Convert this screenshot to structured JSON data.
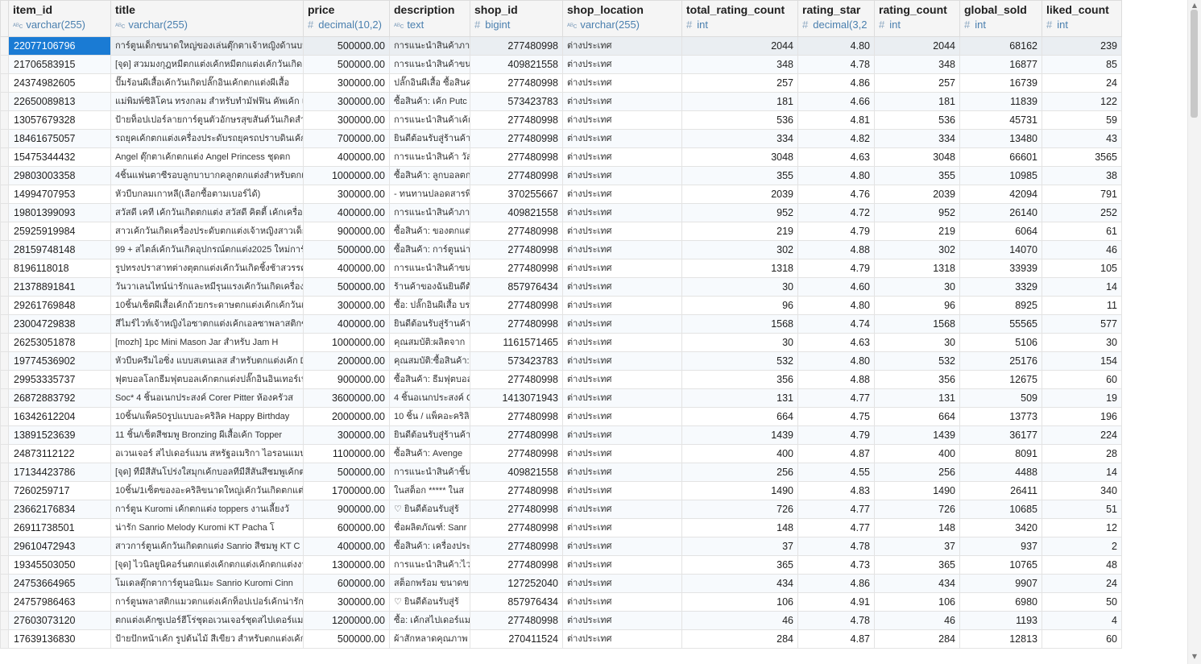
{
  "columns": [
    {
      "name": "item_id",
      "type": "varchar(255)",
      "kind": "text"
    },
    {
      "name": "title",
      "type": "varchar(255)",
      "kind": "text"
    },
    {
      "name": "price",
      "type": "decimal(10,2)",
      "kind": "number"
    },
    {
      "name": "description",
      "type": "text",
      "kind": "text"
    },
    {
      "name": "shop_id",
      "type": "bigint",
      "kind": "number"
    },
    {
      "name": "shop_location",
      "type": "varchar(255)",
      "kind": "text"
    },
    {
      "name": "total_rating_count",
      "type": "int",
      "kind": "number"
    },
    {
      "name": "rating_star",
      "type": "decimal(3,2",
      "kind": "number"
    },
    {
      "name": "rating_count",
      "type": "int",
      "kind": "number"
    },
    {
      "name": "global_sold",
      "type": "int",
      "kind": "number"
    },
    {
      "name": "liked_count",
      "type": "int",
      "kind": "number"
    }
  ],
  "rows": [
    [
      "22077106796",
      "การ์ตูนเด็กขนาดใหญ่ของเล่นตุ๊กตาเจ้าหญิงด้านบนมี",
      "500000.00",
      "การแนะนำสินค้าภาษ",
      "277480998",
      "ต่างประเทศ",
      "2044",
      "4.80",
      "2044",
      "68162",
      "239"
    ],
    [
      "21706583915",
      "[จุด] สวมมงกุฎหมีตกแต่งเค้กหมีตกแต่งเค้กวันเกิด",
      "500000.00",
      "การแนะนำสินค้าขนา",
      "409821558",
      "ต่างประเทศ",
      "348",
      "4.78",
      "348",
      "16877",
      "85"
    ],
    [
      "24374982605",
      "ปั๊มร้อนผีเสื้อเค้กวันเกิดปลั๊กอินเค้กตกแต่งผีเสื้อ",
      "300000.00",
      "ปลั๊กอินผีเสื้อ ซื้อสินค",
      "277480998",
      "ต่างประเทศ",
      "257",
      "4.86",
      "257",
      "16739",
      "24"
    ],
    [
      "22650089813",
      "แม่พิมพ์ซิลิโคน ทรงกลม สำหรับทำมัฟฟิน คัพเค้ก แ",
      "300000.00",
      "ซื้อสินค้า: เค้ก Putc",
      "573423783",
      "ต่างประเทศ",
      "181",
      "4.66",
      "181",
      "11839",
      "122"
    ],
    [
      "13057679328",
      "ป้ายท็อปเปอร์ลายการ์ตูนตัวอักษรสุขสันต์วันเกิดสำหร",
      "300000.00",
      "การแนะนำสินค้าเค้ก",
      "277480998",
      "ต่างประเทศ",
      "536",
      "4.81",
      "536",
      "45731",
      "59"
    ],
    [
      "18461675057",
      "รถยุคเค้กตกแต่งเครื่องประดับรถยุครถปราบดินเค้ก",
      "700000.00",
      "ยินดีต้อนรับสู่ร้านค้า",
      "277480998",
      "ต่างประเทศ",
      "334",
      "4.82",
      "334",
      "13480",
      "43"
    ],
    [
      "15475344432",
      "Angel ตุ๊กตาเค้กตกแต่ง Angel Princess ชุดตก",
      "400000.00",
      "การแนะนำสินค้า วัสด",
      "277480998",
      "ต่างประเทศ",
      "3048",
      "4.63",
      "3048",
      "66601",
      "3565"
    ],
    [
      "29803003358",
      "4ชิ้นแฟนตาซีรอบลูกบาบากคลูกตกแต่งสำหรับตกแ",
      "1000000.00",
      "ซื้อสินค้า: ลูกบอลตก",
      "277480998",
      "ต่างประเทศ",
      "355",
      "4.80",
      "355",
      "10985",
      "38"
    ],
    [
      "14994707953",
      "หัวบีบกลมเกาหลี(เลือกซื้อตามเบอร์ได้)",
      "300000.00",
      "- ทนทานปลอดสารพิ",
      "370255667",
      "ต่างประเทศ",
      "2039",
      "4.76",
      "2039",
      "42094",
      "791"
    ],
    [
      "19801399093",
      "สวัสดี เคที เค้กวันเกิดตกแต่ง สวัสดี คิตตี้ เค้กเครื่องแ",
      "400000.00",
      "การแนะนำสินค้าภาษ",
      "409821558",
      "ต่างประเทศ",
      "952",
      "4.72",
      "952",
      "26140",
      "252"
    ],
    [
      "25925919984",
      "สาวเค้กวันเกิดเครื่องประดับตกแต่งเจ้าหญิงสาวเด็กอ",
      "900000.00",
      "ซื้อสินค้า: ของตกแต่",
      "277480998",
      "ต่างประเทศ",
      "219",
      "4.79",
      "219",
      "6064",
      "61"
    ],
    [
      "28159748148",
      "99 + สไตล์เค้กวันเกิดอุปกรณ์ตกแต่ง2025 ใหม่การ์",
      "500000.00",
      "ซื้อสินค้า: การ์ตูนน่า",
      "277480998",
      "ต่างประเทศ",
      "302",
      "4.88",
      "302",
      "14070",
      "46"
    ],
    [
      "8196118018",
      "รูปทรงปราสาทต่างตุตกแต่งเค้กวันเกิดชิ้งช้าสวรรค์เจ้",
      "400000.00",
      "การแนะนำสินค้าขนา",
      "277480998",
      "ต่างประเทศ",
      "1318",
      "4.79",
      "1318",
      "33939",
      "105"
    ],
    [
      "21378891841",
      "วันวาเลนไทน์น่ารักและหมีรุนแรงเค้กวันเกิดเครื่องประ",
      "500000.00",
      "ร้านค้าของฉันยินดีต้",
      "857976434",
      "ต่างประเทศ",
      "30",
      "4.60",
      "30",
      "3329",
      "14"
    ],
    [
      "29261769848",
      "10ชิ้น/เซ็ตผีเสื้อเค้กถ้วยกระดาษตกแต่งเค้กเค้กวันเกิ",
      "300000.00",
      "ซื้อ: ปลั๊กอินผีเสื้อ บร",
      "277480998",
      "ต่างประเทศ",
      "96",
      "4.80",
      "96",
      "8925",
      "11"
    ],
    [
      "23004729838",
      "สีไมร์ไวท์เจ้าหญิงไอซาตกแต่งเค้กเอลซาพลาสติกของ",
      "400000.00",
      "ยินดีต้อนรับสู่ร้านค้า",
      "277480998",
      "ต่างประเทศ",
      "1568",
      "4.74",
      "1568",
      "55565",
      "577"
    ],
    [
      "26253051878",
      "[mozh] 1pc Mini Mason Jar สำหรับ Jam H",
      "1000000.00",
      "คุณสมบัติ:ผลิตจาก",
      "1161571465",
      "ต่างประเทศ",
      "30",
      "4.63",
      "30",
      "5106",
      "30"
    ],
    [
      "19774536902",
      "หัวบีบครีมไอซิ่ง แบบสเตนเลส สำหรับตกแต่งเค้ก DI",
      "200000.00",
      "คุณสมบัติ:ซื้อสินค้า:",
      "573423783",
      "ต่างประเทศ",
      "532",
      "4.80",
      "532",
      "25176",
      "154"
    ],
    [
      "29953335737",
      "ฟุตบอลโลกธีมฟุตบอลเค้กตกแต่งปลั๊กอินอินเทอร์เน็ต",
      "900000.00",
      "ซื้อสินค้า: ธีมฟุตบอล",
      "277480998",
      "ต่างประเทศ",
      "356",
      "4.88",
      "356",
      "12675",
      "60"
    ],
    [
      "26872883792",
      "Soc* 4 ชิ้นอเนกประสงค์ Corer Pitter ห้องครัวส",
      "3600000.00",
      "4 ชิ้นอเนกประสงค์ C",
      "1413071943",
      "ต่างประเทศ",
      "131",
      "4.77",
      "131",
      "509",
      "19"
    ],
    [
      "16342612204",
      "10ชิ้น/แพ็ค50รูปแบบอะคริลิค Happy Birthday",
      "2000000.00",
      "10 ชิ้น / แพ็คอะคริลิ",
      "277480998",
      "ต่างประเทศ",
      "664",
      "4.75",
      "664",
      "13773",
      "196"
    ],
    [
      "13891523639",
      "11 ชิ้น/เซ็ตสีชมพู Bronzing ผีเสื้อเค้ก Topper",
      "300000.00",
      "ยินดีต้อนรับสู่ร้านค้า",
      "277480998",
      "ต่างประเทศ",
      "1439",
      "4.79",
      "1439",
      "36177",
      "224"
    ],
    [
      "24873112122",
      "อเวนเจอร์ สไปเดอร์แมน สหรัฐอเมริกา ไอรอนแมน ซุเ",
      "1100000.00",
      "ซื้อสินค้า: Avenge",
      "277480998",
      "ต่างประเทศ",
      "400",
      "4.87",
      "400",
      "8091",
      "28"
    ],
    [
      "17134423786",
      "[จุด] ทีมีสีสันโปร่งใสมุกเค้กบอลทีมีสีสันสีชมพูเค้กตก",
      "500000.00",
      "การแนะนำสินค้าชิ้นเ",
      "409821558",
      "ต่างประเทศ",
      "256",
      "4.55",
      "256",
      "4488",
      "14"
    ],
    [
      "7260259717",
      "10ชิ้น/1เซ็ตของอะคริลิขนาดใหญ่เค้กวันเกิดตกแต่งเ",
      "1700000.00",
      "ในสต็อก ***** ในส",
      "277480998",
      "ต่างประเทศ",
      "1490",
      "4.83",
      "1490",
      "26411",
      "340"
    ],
    [
      "23662176834",
      "การ์ตูน Kuromi เค้กตกแต่ง toppers งานเลี้ยงวั",
      "900000.00",
      "♡ ยินดีต้อนรับสู่ร้",
      "277480998",
      "ต่างประเทศ",
      "726",
      "4.77",
      "726",
      "10685",
      "51"
    ],
    [
      "26911738501",
      "น่ารัก Sanrio Melody Kuromi KT Pacha โ",
      "600000.00",
      "ชื่อผลิตภัณฑ์: Sanr",
      "277480998",
      "ต่างประเทศ",
      "148",
      "4.77",
      "148",
      "3420",
      "12"
    ],
    [
      "29610472943",
      "สาวการ์ตูนเค้กวันเกิดตกแต่ง Sanrio สีชมพู KT C",
      "400000.00",
      "ซื้อสินค้า: เครื่องประ",
      "277480998",
      "ต่างประเทศ",
      "37",
      "4.78",
      "37",
      "937",
      "2"
    ],
    [
      "19345503050",
      "[จุด] ไวนิลยูนิคอร์นตกแต่งเค้กตกแต่งเค้กตกแต่งงา",
      "1300000.00",
      "การแนะนำสินค้า:ไวนิ",
      "277480998",
      "ต่างประเทศ",
      "365",
      "4.73",
      "365",
      "10765",
      "48"
    ],
    [
      "24753664965",
      "โมเดลตุ๊กตาการ์ตูนอนิเมะ Sanrio Kuromi Cinn",
      "600000.00",
      "สต็อกพร้อม ขนาดข",
      "127252040",
      "ต่างประเทศ",
      "434",
      "4.86",
      "434",
      "9907",
      "24"
    ],
    [
      "24757986463",
      "การ์ตูนพลาสติกแมวตกแต่งเค้กท็อปเปอร์เค้กน่ารักเค้",
      "300000.00",
      "♡ ยินดีต้อนรับสู่ร้",
      "857976434",
      "ต่างประเทศ",
      "106",
      "4.91",
      "106",
      "6980",
      "50"
    ],
    [
      "27603073120",
      "ตกแต่งเค้กซูเปอร์ฮีโร่ชุดอเวนเจอร์ชุดสไปเดอร์แมนค",
      "1200000.00",
      "ซื้อ: เค้กสไปเดอร์แมน",
      "277480998",
      "ต่างประเทศ",
      "46",
      "4.78",
      "46",
      "1193",
      "4"
    ],
    [
      "17639136830",
      "ป้ายปักหน้าเค้ก รูปต้นไม้ สีเขียว สำหรับตกแต่งเค้ก 3",
      "500000.00",
      "ผ้าสักหลาดคุณภาพ",
      "270411524",
      "ต่างประเทศ",
      "284",
      "4.87",
      "284",
      "12813",
      "60"
    ]
  ]
}
